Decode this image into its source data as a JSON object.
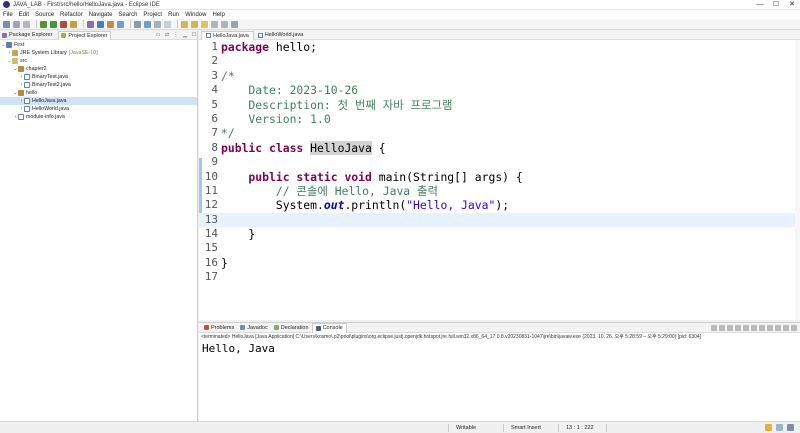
{
  "window": {
    "title": "JAVA_LAB - First/src/hello/HelloJava.java - Eclipse IDE",
    "controls": [
      "—",
      "☐",
      "✕"
    ]
  },
  "menu": [
    "File",
    "Edit",
    "Source",
    "Refactor",
    "Navigate",
    "Search",
    "Project",
    "Run",
    "Window",
    "Help"
  ],
  "left": {
    "tabs": [
      {
        "label": "Package Explorer"
      },
      {
        "label": "Project Explorer"
      }
    ],
    "tree": [
      {
        "label": "First",
        "extra": ""
      },
      {
        "label": "JRE System Library",
        "extra": "[JavaSE-10]"
      },
      {
        "label": "src",
        "extra": ""
      },
      {
        "label": "chapter2",
        "extra": ""
      },
      {
        "label": "BinaryTest.java",
        "extra": ""
      },
      {
        "label": "BinaryTest2.java",
        "extra": ""
      },
      {
        "label": "hello",
        "extra": ""
      },
      {
        "label": "HelloJava.java",
        "extra": ""
      },
      {
        "label": "HelloWorld.java",
        "extra": ""
      },
      {
        "label": "module-info.java",
        "extra": ""
      }
    ]
  },
  "editor": {
    "tabs": [
      {
        "label": "HelloJava.java"
      },
      {
        "label": "HelloWorld.java"
      }
    ],
    "line_numbers": [
      "1",
      "2",
      "3",
      "4",
      "5",
      "6",
      "7",
      "8",
      "9",
      "10",
      "11",
      "12",
      "13",
      "14",
      "15",
      "16",
      "17"
    ],
    "code": {
      "l1_kw": "package",
      "l1_rest": " hello;",
      "l3": "/*",
      "l4": "    Date: 2023-10-26",
      "l5": "    Description: 첫 번째 자바 프로그램",
      "l6": "    Version: 1.0",
      "l7": "*/",
      "l8_kw": "public class",
      "l8_cls": "HelloJava",
      "l8_rest": " {",
      "l10_kw": "    public static void",
      "l10_rest": " main(String[] args) {",
      "l11": "        // 콘솔에 Hello, Java 출력",
      "l12_a": "        System.",
      "l12_field": "out",
      "l12_b": ".println(",
      "l12_str": "\"Hello, Java\"",
      "l12_c": ");",
      "l14": "    }",
      "l16": "}"
    }
  },
  "bottom": {
    "tabs": [
      {
        "label": "Problems"
      },
      {
        "label": "Javadoc"
      },
      {
        "label": "Declaration"
      },
      {
        "label": "Console"
      }
    ],
    "console_header": "<terminated> HelloJava [Java Application] C:\\Users\\kosmo\\.p2\\pool\\plugins\\org.eclipse.justj.openjdk.hotspot.jre.full.win32.x86_64_17.0.8.v20230831-1047\\jre\\bin\\javaw.exe  (2023. 10. 26. 오후 5:28:59 – 오후 5:29:00) [pid: 6304]",
    "console_output": "Hello, Java"
  },
  "status": {
    "writable": "Writable",
    "insert": "Smart Insert",
    "position": "13 : 1 : 222"
  }
}
